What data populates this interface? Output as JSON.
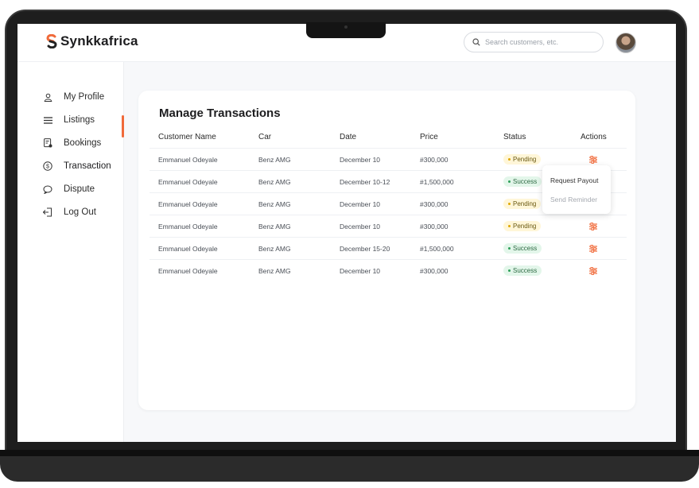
{
  "brand": {
    "name": "Synkkafrica",
    "accent": "#f06a3a"
  },
  "search": {
    "placeholder": "Search customers, etc."
  },
  "sidebar": {
    "items": [
      {
        "label": "My Profile",
        "icon": "user-icon"
      },
      {
        "label": "Listings",
        "icon": "list-icon"
      },
      {
        "label": "Bookings",
        "icon": "calendar-icon"
      },
      {
        "label": "Transaction",
        "icon": "dollar-circle-icon",
        "active": true
      },
      {
        "label": "Dispute",
        "icon": "chat-icon"
      },
      {
        "label": "Log Out",
        "icon": "logout-icon"
      }
    ]
  },
  "main": {
    "title": "Manage Transactions",
    "columns": [
      "Customer Name",
      "Car",
      "Date",
      "Price",
      "Status",
      "Actions"
    ],
    "rows": [
      {
        "customer": "Emmanuel Odeyale",
        "car": "Benz AMG",
        "date": "December 10",
        "price": "#300,000",
        "status": "Pending"
      },
      {
        "customer": "Emmanuel Odeyale",
        "car": "Benz AMG",
        "date": "December 10-12",
        "price": "#1,500,000",
        "status": "Success"
      },
      {
        "customer": "Emmanuel Odeyale",
        "car": "Benz AMG",
        "date": "December 10",
        "price": "#300,000",
        "status": "Pending"
      },
      {
        "customer": "Emmanuel Odeyale",
        "car": "Benz AMG",
        "date": "December 10",
        "price": "#300,000",
        "status": "Pending"
      },
      {
        "customer": "Emmanuel Odeyale",
        "car": "Benz AMG",
        "date": "December 15-20",
        "price": "#1,500,000",
        "status": "Success"
      },
      {
        "customer": "Emmanuel Odeyale",
        "car": "Benz AMG",
        "date": "December 10",
        "price": "#300,000",
        "status": "Success"
      }
    ],
    "action_icon": "sliders-icon",
    "action_menu": {
      "items": [
        "Request Payout",
        "Send Reminder"
      ]
    }
  }
}
